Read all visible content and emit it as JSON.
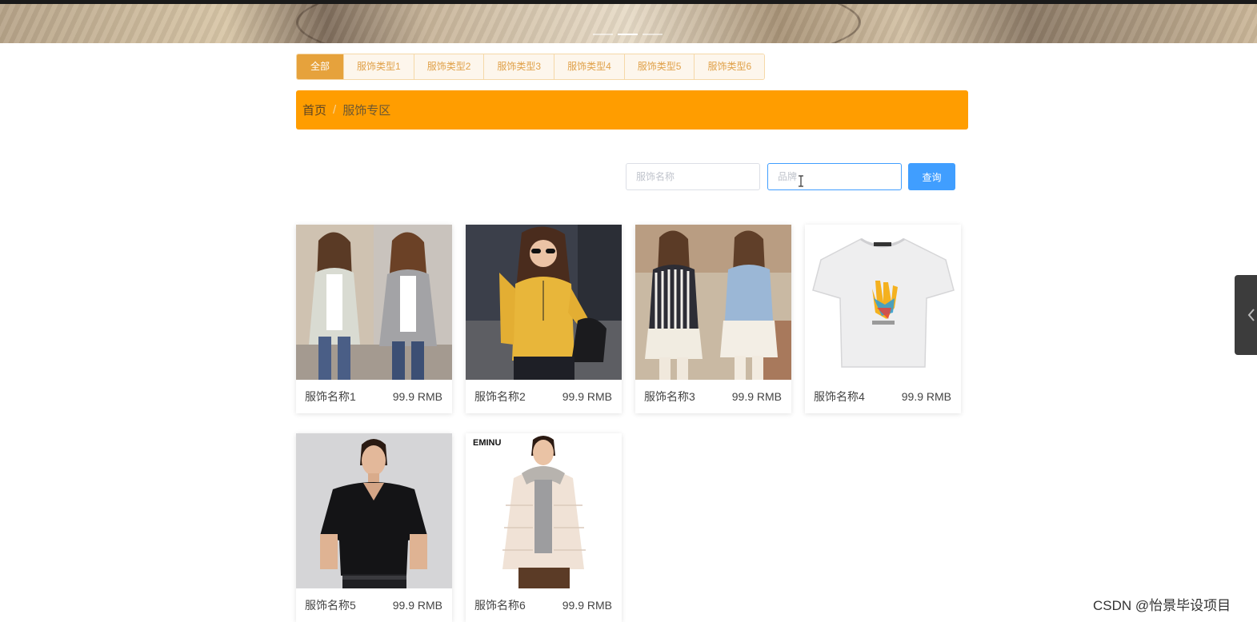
{
  "banner": {
    "slides": [
      {
        "active": false
      },
      {
        "active": true
      },
      {
        "active": false
      }
    ]
  },
  "tabs": [
    {
      "label": "全部",
      "active": true
    },
    {
      "label": "服饰类型1",
      "active": false
    },
    {
      "label": "服饰类型2",
      "active": false
    },
    {
      "label": "服饰类型3",
      "active": false
    },
    {
      "label": "服饰类型4",
      "active": false
    },
    {
      "label": "服饰类型5",
      "active": false
    },
    {
      "label": "服饰类型6",
      "active": false
    }
  ],
  "breadcrumb": {
    "home": "首页",
    "separator": "/",
    "current": "服饰专区"
  },
  "search": {
    "name_placeholder": "服饰名称",
    "name_value": "",
    "brand_placeholder": "品牌",
    "brand_value": "",
    "button_label": "查询"
  },
  "products": [
    {
      "name": "服饰名称1",
      "price": "99.9 RMB",
      "image": "two-women-cardigans"
    },
    {
      "name": "服饰名称2",
      "price": "99.9 RMB",
      "image": "woman-yellow-sweater"
    },
    {
      "name": "服饰名称3",
      "price": "99.9 RMB",
      "image": "two-women-lace-tops"
    },
    {
      "name": "服饰名称4",
      "price": "99.9 RMB",
      "image": "white-tshirt-handprint"
    },
    {
      "name": "服饰名称5",
      "price": "99.9 RMB",
      "image": "man-black-tshirt"
    },
    {
      "name": "服饰名称6",
      "price": "99.9 RMB",
      "image": "man-puffer-jacket",
      "image_brand_text": "EMINU"
    }
  ],
  "watermark": "CSDN @怡景毕设项目",
  "colors": {
    "tab_active": "#e6a23c",
    "breadcrumb_bg": "#ff9d00",
    "primary_button": "#409eff"
  }
}
